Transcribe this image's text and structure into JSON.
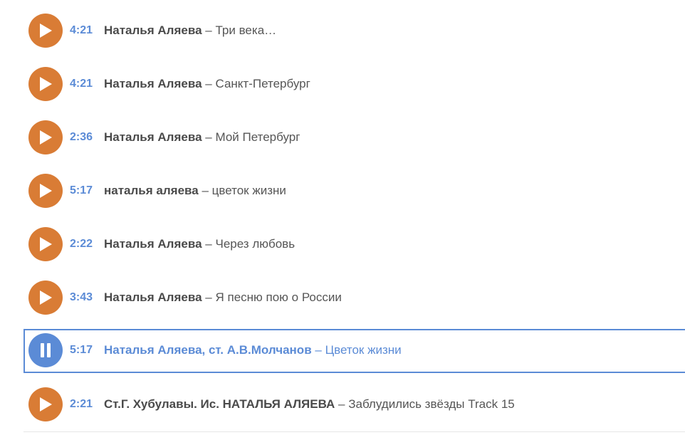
{
  "colors": {
    "play_button": "#d97c35",
    "pause_button": "#5b8bd6",
    "duration": "#5b8bd6",
    "artist": "#4a4a4a",
    "song": "#555555",
    "active_text": "#5b8bd6",
    "active_border": "#5b8bd6"
  },
  "separator": "–",
  "tracks": [
    {
      "duration": "4:21",
      "artist": "Наталья Аляева",
      "song": "Три века…",
      "state": "play-icon"
    },
    {
      "duration": "4:21",
      "artist": "Наталья Аляева",
      "song": "Санкт-Петербург",
      "state": "play-icon"
    },
    {
      "duration": "2:36",
      "artist": "Наталья Аляева",
      "song": "Мой Петербург",
      "state": "play-icon"
    },
    {
      "duration": "5:17",
      "artist": "наталья аляева",
      "song": "цветок жизни",
      "state": "play-icon"
    },
    {
      "duration": "2:22",
      "artist": "Наталья Аляева",
      "song": "Через любовь",
      "state": "play-icon"
    },
    {
      "duration": "3:43",
      "artist": "Наталья Аляева",
      "song": "Я песню пою о России",
      "state": "play-icon"
    },
    {
      "duration": "5:17",
      "artist": "Наталья Аляева, ст. А.В.Молчанов",
      "song": "Цветок жизни",
      "state": "pause-icon",
      "active": true
    },
    {
      "duration": "2:21",
      "artist": "Ст.Г. Хубулавы. Ис. НАТАЛЬЯ АЛЯЕВА",
      "song": "Заблудились звёзды Track 15",
      "state": "play-icon"
    }
  ]
}
